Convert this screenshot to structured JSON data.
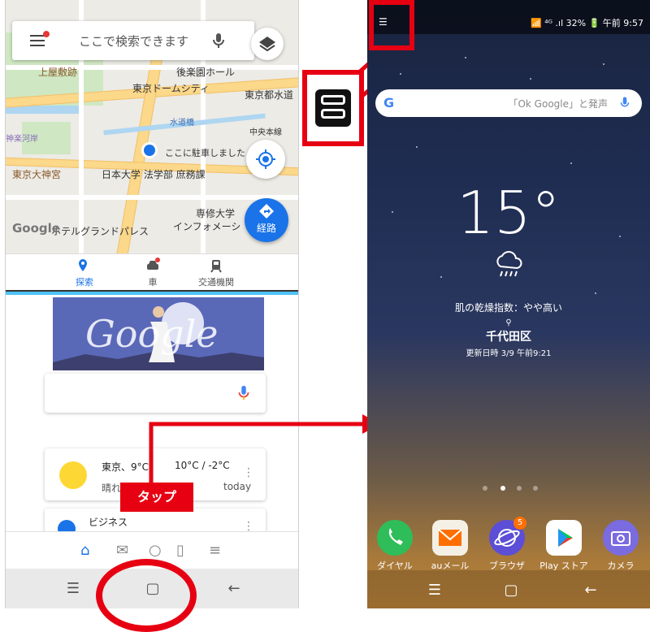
{
  "left_phone": {
    "search": {
      "placeholder": "ここで検索できます"
    },
    "map_labels": {
      "kamiyashiki": "上屋敷跡",
      "korakuen_hall": "後楽園ホール",
      "tokyo_dome_city": "東京ドームシティ",
      "tokyo_water": "東京都水道",
      "suidobashi": "水道橋",
      "chuo_line": "中央本線",
      "parked_here": "ここに駐車しました",
      "daijingu": "東京大神宮",
      "nihon_univ": "日本大学 法学部 庶務課",
      "senshu_univ": "専修大学",
      "grand_palace": "ホテルグランドパレス",
      "info": "インフォメーシ",
      "shinkawa": "神楽河岸",
      "route_label": "経路",
      "google": "Google"
    },
    "tabs": [
      {
        "label": "探索",
        "active": true
      },
      {
        "label": "車",
        "active": false
      },
      {
        "label": "交通機関",
        "active": false
      }
    ],
    "doodle_text": "Google",
    "weather": {
      "city": "東京、9°C",
      "range": "10°C / -2°C",
      "condition": "晴れ",
      "today": "today"
    },
    "business": {
      "label": "ビジネス"
    },
    "bottom_tabs": [
      "home-icon",
      "updates-icon",
      "search-icon",
      "tabs-icon",
      "menu-icon"
    ],
    "nav": [
      "recent-apps-icon",
      "home-icon",
      "back-icon"
    ]
  },
  "annotation": {
    "tap_label": "タップ",
    "accent": "#e60012"
  },
  "right_phone": {
    "status_right": "📶 ⁴ᴳ .ıl 32% 🔋 午前 9:57",
    "search_hint": "「Ok Google」と発声",
    "temperature": "15°",
    "dryness": "肌の乾燥指数：やや高い",
    "location": "千代田区",
    "updated": "更新日時 3/9 午前9:21",
    "apps": [
      {
        "label": "ダイヤル",
        "color": "#2ebd59",
        "badge": ""
      },
      {
        "label": "auメール",
        "color": "#f5f0e6",
        "badge": ""
      },
      {
        "label": "ブラウザ",
        "color": "#5c4ed6",
        "badge": "5"
      },
      {
        "label": "Play ストア",
        "color": "#ffffff",
        "badge": ""
      },
      {
        "label": "カメラ",
        "color": "#7a6be0",
        "badge": ""
      }
    ]
  }
}
